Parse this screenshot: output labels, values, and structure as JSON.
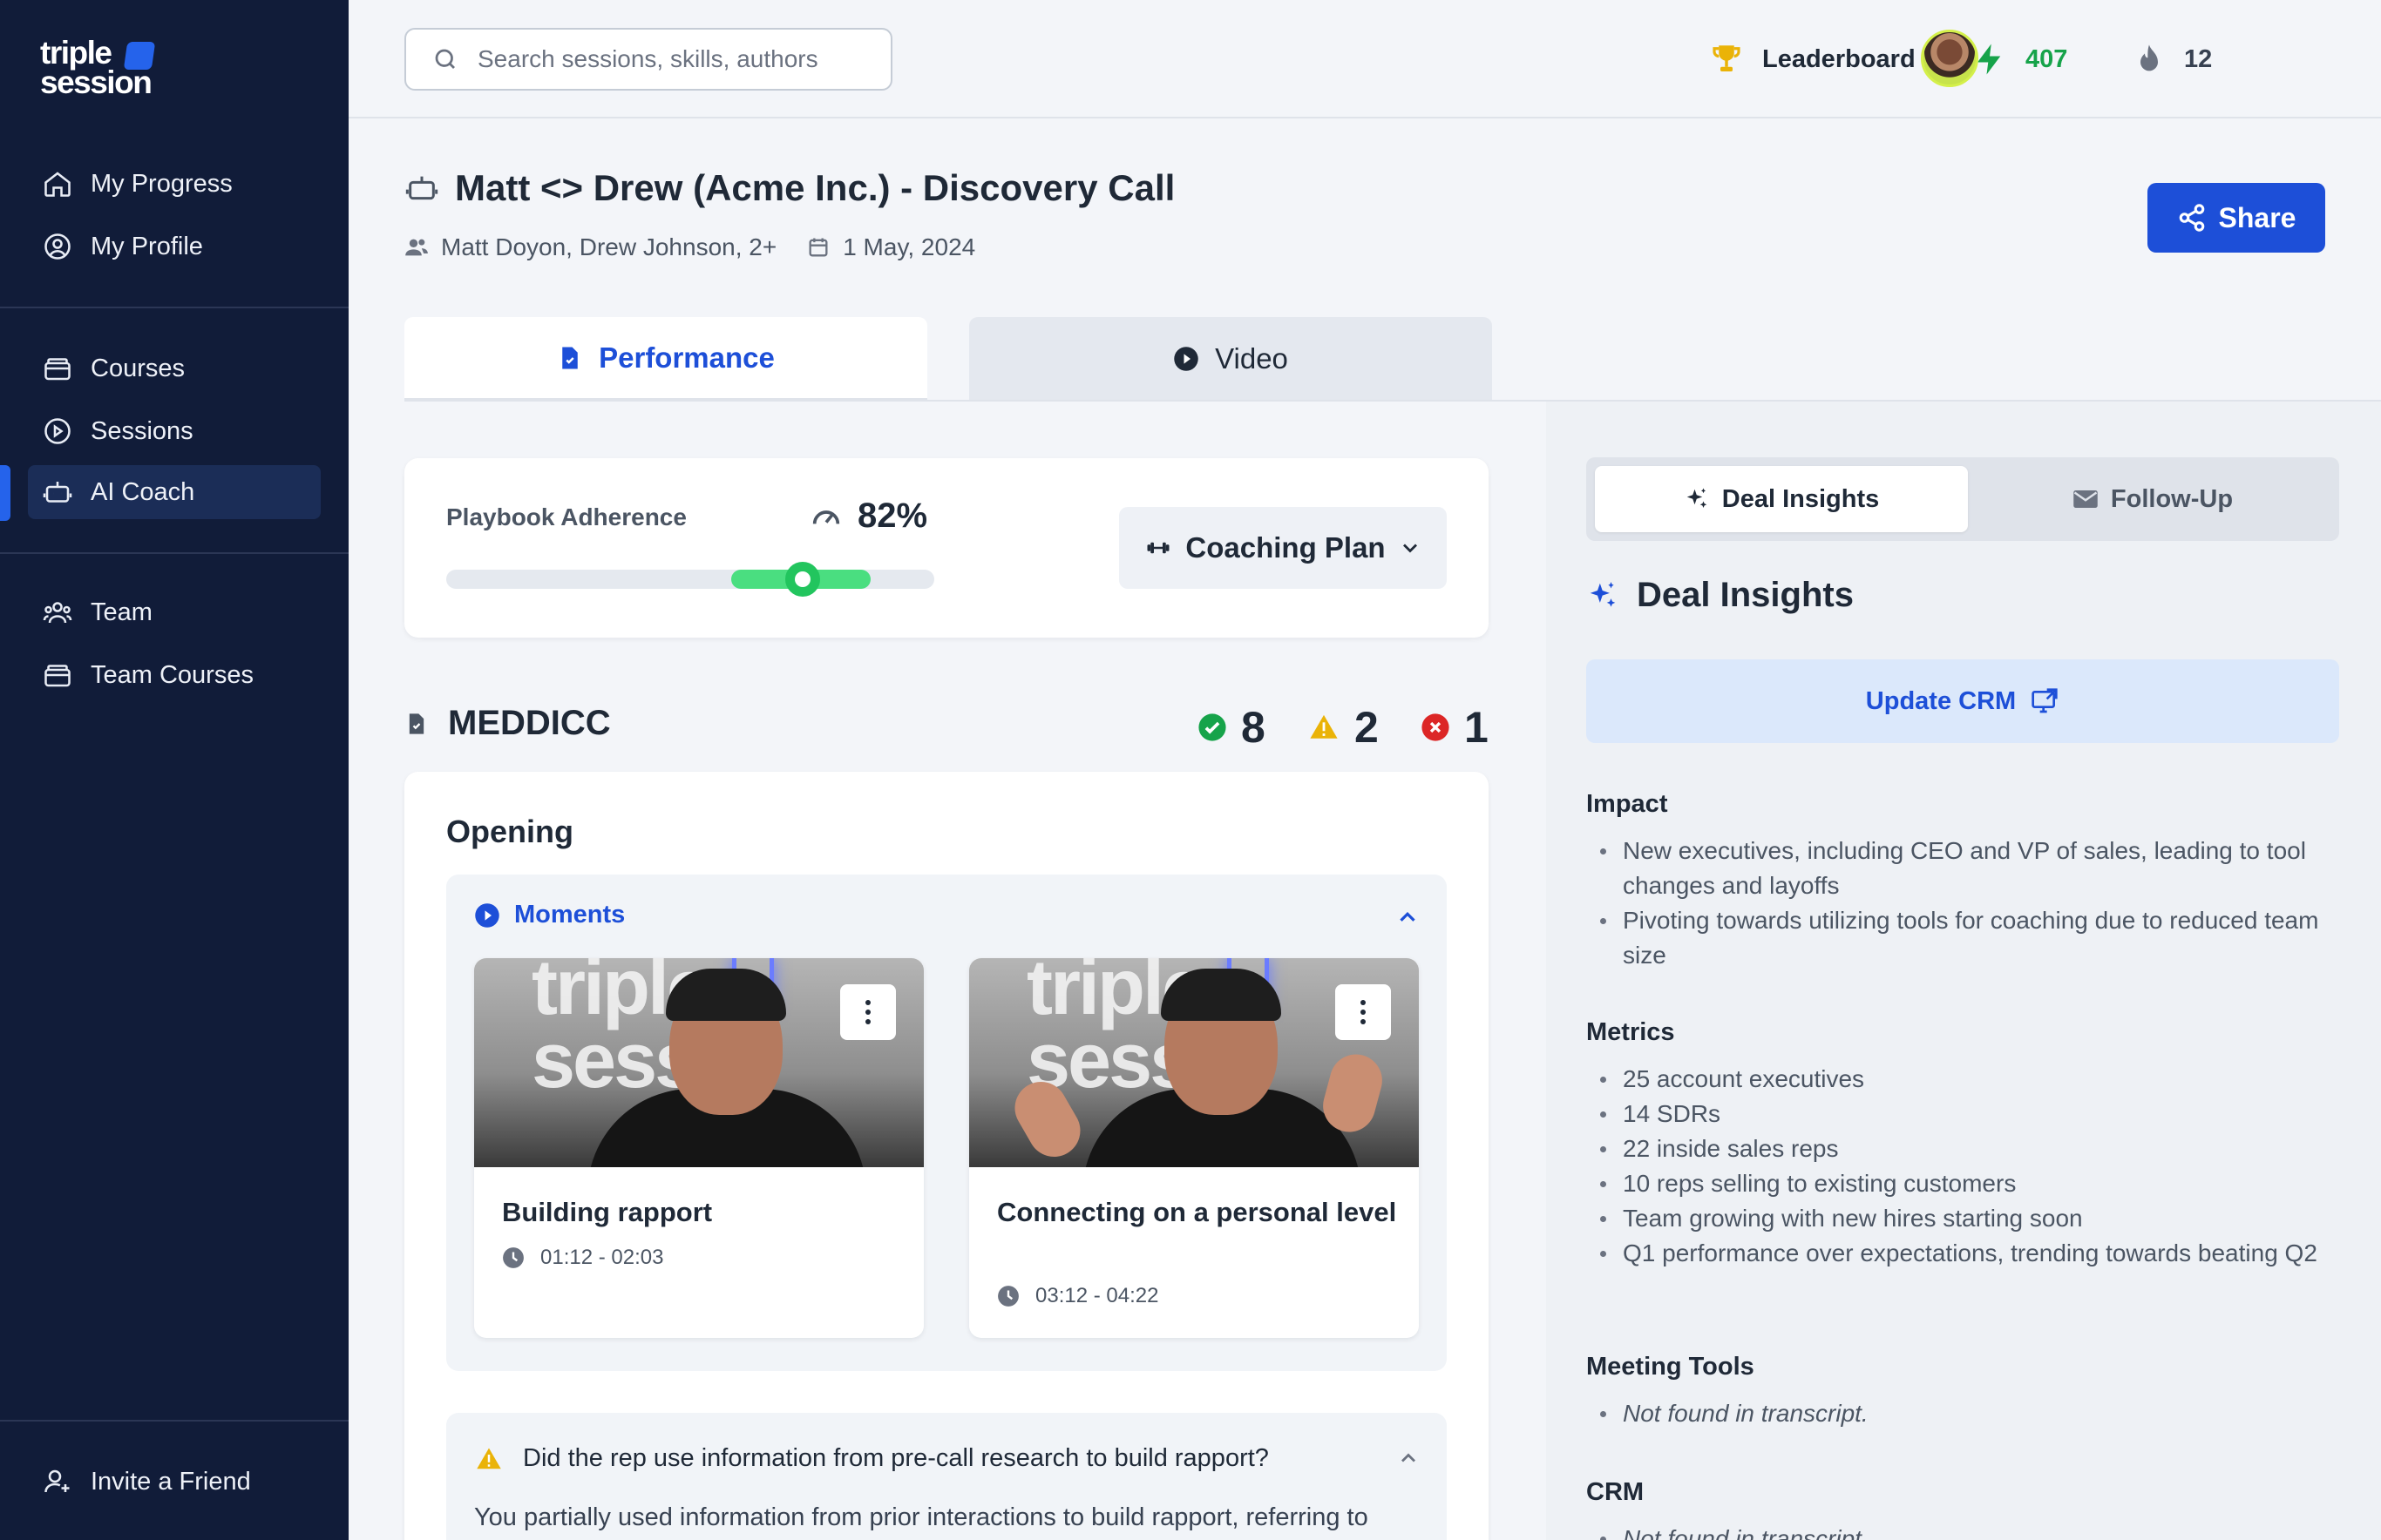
{
  "app": {
    "logo_line1": "triple",
    "logo_line2": "session"
  },
  "sidebar": {
    "items": [
      {
        "label": "My Progress",
        "icon": "home-icon"
      },
      {
        "label": "My Profile",
        "icon": "user-circle-icon"
      },
      {
        "label": "Courses",
        "icon": "archive-icon"
      },
      {
        "label": "Sessions",
        "icon": "play-circle-icon"
      },
      {
        "label": "AI Coach",
        "icon": "robot-icon",
        "active": true
      },
      {
        "label": "Team",
        "icon": "users-icon"
      },
      {
        "label": "Team Courses",
        "icon": "archive-icon"
      }
    ],
    "footer": {
      "label": "Invite a Friend",
      "icon": "user-plus-icon"
    }
  },
  "topbar": {
    "search_placeholder": "Search sessions, skills, authors",
    "leaderboard_label": "Leaderboard",
    "points": "407",
    "streak": "12"
  },
  "header": {
    "title": "Matt <> Drew (Acme Inc.) - Discovery Call",
    "participants": "Matt Doyon, Drew Johnson, 2+",
    "date": "1 May, 2024",
    "share_label": "Share"
  },
  "tabs": [
    {
      "label": "Performance",
      "active": true
    },
    {
      "label": "Video",
      "active": false
    }
  ],
  "adherence": {
    "label": "Playbook Adherence",
    "value": "82%",
    "level": 0.73,
    "coaching_label": "Coaching Plan"
  },
  "meddicc": {
    "title": "MEDDICC",
    "passed": "8",
    "warnings": "2",
    "failed": "1"
  },
  "opening": {
    "title": "Opening",
    "moments_label": "Moments",
    "moments": [
      {
        "title": "Building rapport",
        "time": "01:12 - 02:03"
      },
      {
        "title": "Connecting on a personal level",
        "time": "03:12 - 04:22"
      }
    ],
    "question": "Did the rep use information from pre-call research to build rapport?",
    "answer": "You partially used information from prior interactions to build rapport, referring to"
  },
  "insights": {
    "tab_active": "Deal Insights",
    "tab_inactive": "Follow-Up",
    "title": "Deal Insights",
    "update_crm_label": "Update CRM",
    "impact_title": "Impact",
    "impact": [
      "New executives, including CEO and VP of sales, leading to tool changes and layoffs",
      "Pivoting towards utilizing tools for coaching due to reduced team size"
    ],
    "metrics_title": "Metrics",
    "metrics": [
      "25 account executives",
      "14 SDRs",
      "22 inside sales reps",
      "10 reps selling to existing customers",
      "Team growing with new hires starting soon",
      "Q1 performance over expectations, trending towards beating Q2"
    ],
    "meeting_tools_title": "Meeting Tools",
    "meeting_tools": "Not found in transcript.",
    "crm_title": "CRM",
    "crm": "Not found in transcript."
  },
  "colors": {
    "sidebar_bg": "#111c39",
    "accent": "#1d4fd8",
    "success": "#16a34a",
    "warning": "#eab308",
    "danger": "#dc2626"
  }
}
